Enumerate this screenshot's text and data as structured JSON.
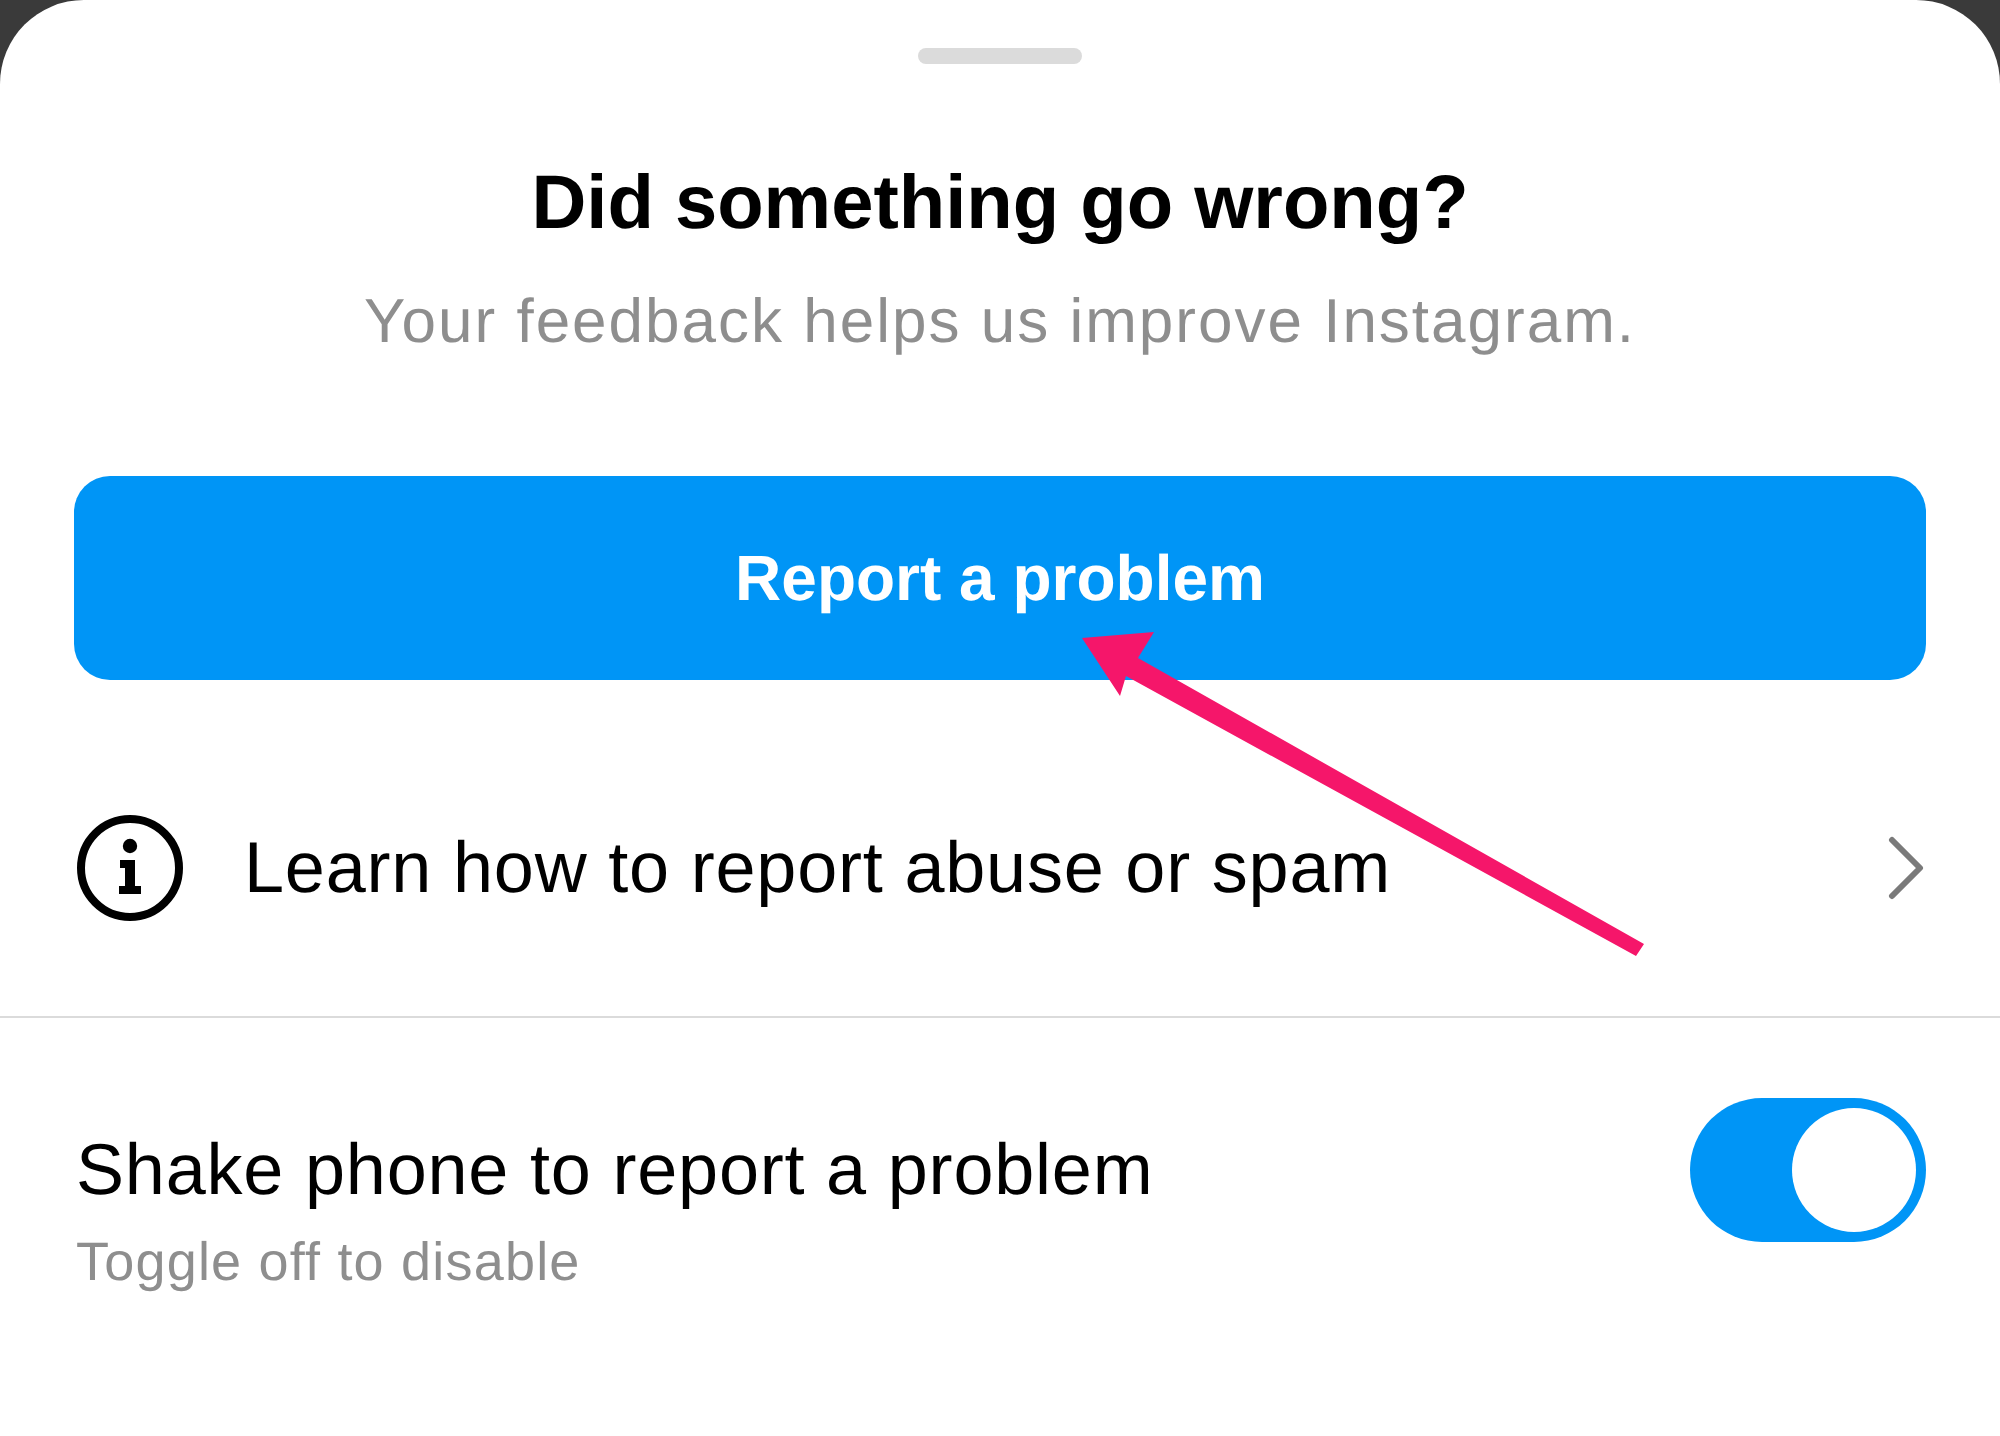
{
  "sheet": {
    "title": "Did something go wrong?",
    "subtitle": "Your feedback helps us improve Instagram."
  },
  "primary_button": {
    "label": "Report a problem"
  },
  "help_link": {
    "label": "Learn how to report abuse or spam"
  },
  "setting": {
    "label": "Shake phone to report a problem",
    "hint": "Toggle off to disable",
    "on": true
  }
}
